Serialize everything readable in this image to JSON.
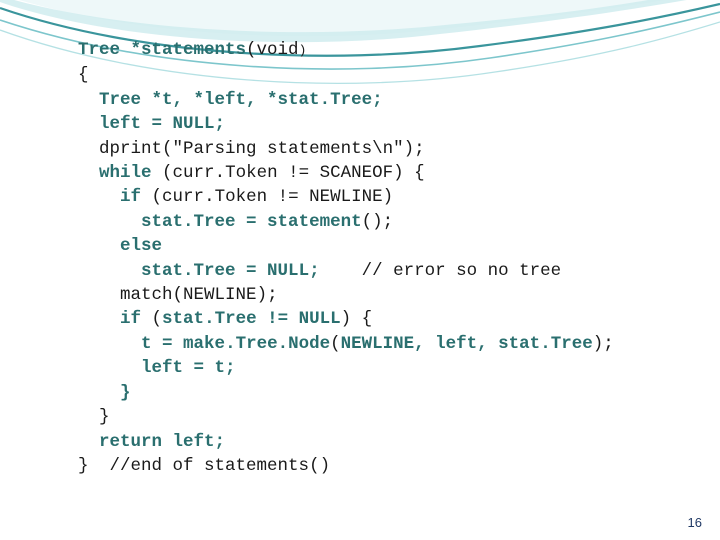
{
  "slide": {
    "page_number": "16",
    "accent_colors": {
      "teal_dark": "#1f6f6f",
      "teal_mid": "#3aa6a6",
      "teal_light": "#9fd9d9",
      "page_number_color": "#1f3864"
    },
    "code": {
      "lines": [
        {
          "indent": 0,
          "segments": [
            {
              "text": "Tree *statements",
              "style": "teal"
            },
            {
              "text": "(",
              "style": "plain"
            },
            {
              "text": "void",
              "style": "plain"
            },
            {
              "text": ")",
              "style": "small"
            }
          ]
        },
        {
          "indent": 0,
          "segments": [
            {
              "text": "{",
              "style": "plain"
            }
          ]
        },
        {
          "indent": 1,
          "segments": [
            {
              "text": "Tree *t, *left, *stat",
              "style": "teal"
            },
            {
              "text": ".",
              "style": "teal"
            },
            {
              "text": "Tree;",
              "style": "teal"
            }
          ]
        },
        {
          "indent": 1,
          "segments": [
            {
              "text": "left",
              "style": "teal"
            },
            {
              "text": " = ",
              "style": "teal"
            },
            {
              "text": "NULL;",
              "style": "teal"
            }
          ]
        },
        {
          "indent": 1,
          "segments": [
            {
              "text": "dprint",
              "style": "plain"
            },
            {
              "text": "(",
              "style": "plain"
            },
            {
              "text": "\"Parsing statements\\n\"",
              "style": "plain"
            },
            {
              "text": ");",
              "style": "plain"
            }
          ]
        },
        {
          "indent": 1,
          "segments": [
            {
              "text": "while",
              "style": "teal"
            },
            {
              "text": " (",
              "style": "plain"
            },
            {
              "text": "curr",
              "style": "plain"
            },
            {
              "text": ".",
              "style": "plain"
            },
            {
              "text": "Token != SCANEOF",
              "style": "plain"
            },
            {
              "text": ") {",
              "style": "plain"
            }
          ]
        },
        {
          "indent": 2,
          "segments": [
            {
              "text": "if",
              "style": "teal"
            },
            {
              "text": " (",
              "style": "plain"
            },
            {
              "text": "curr",
              "style": "plain"
            },
            {
              "text": ".",
              "style": "plain"
            },
            {
              "text": "Token != NEWLINE",
              "style": "plain"
            },
            {
              "text": ")",
              "style": "plain"
            }
          ]
        },
        {
          "indent": 3,
          "segments": [
            {
              "text": "stat",
              "style": "teal"
            },
            {
              "text": ".",
              "style": "teal"
            },
            {
              "text": "Tree = statement",
              "style": "teal"
            },
            {
              "text": "();",
              "style": "plain"
            }
          ]
        },
        {
          "indent": 2,
          "segments": [
            {
              "text": "else",
              "style": "teal"
            }
          ]
        },
        {
          "indent": 3,
          "segments": [
            {
              "text": "stat",
              "style": "teal"
            },
            {
              "text": ".",
              "style": "teal"
            },
            {
              "text": "Tree = NULL;",
              "style": "teal"
            },
            {
              "text": "    // error so no tree",
              "style": "plain"
            }
          ]
        },
        {
          "indent": 2,
          "segments": [
            {
              "text": "match",
              "style": "plain"
            },
            {
              "text": "(",
              "style": "plain"
            },
            {
              "text": "NEWLINE",
              "style": "plain"
            },
            {
              "text": ");",
              "style": "plain"
            }
          ]
        },
        {
          "indent": 2,
          "segments": [
            {
              "text": "if",
              "style": "teal"
            },
            {
              "text": " (",
              "style": "plain"
            },
            {
              "text": "stat",
              "style": "teal"
            },
            {
              "text": ".",
              "style": "teal"
            },
            {
              "text": "Tree != NULL",
              "style": "teal"
            },
            {
              "text": ") {",
              "style": "plain"
            }
          ]
        },
        {
          "indent": 3,
          "segments": [
            {
              "text": "t",
              "style": "teal"
            },
            {
              "text": " = ",
              "style": "teal"
            },
            {
              "text": "make",
              "style": "teal"
            },
            {
              "text": ".",
              "style": "teal"
            },
            {
              "text": "Tree",
              "style": "teal"
            },
            {
              "text": ".",
              "style": "teal"
            },
            {
              "text": "Node",
              "style": "teal"
            },
            {
              "text": "(",
              "style": "plain"
            },
            {
              "text": "NEWLINE, left, stat",
              "style": "teal"
            },
            {
              "text": ".",
              "style": "teal"
            },
            {
              "text": "Tree",
              "style": "teal"
            },
            {
              "text": ");",
              "style": "plain"
            }
          ]
        },
        {
          "indent": 3,
          "segments": [
            {
              "text": "left",
              "style": "teal"
            },
            {
              "text": " = ",
              "style": "teal"
            },
            {
              "text": "t;",
              "style": "teal"
            }
          ]
        },
        {
          "indent": 2,
          "segments": [
            {
              "text": "}",
              "style": "teal"
            }
          ]
        },
        {
          "indent": 1,
          "segments": [
            {
              "text": "}",
              "style": "plain"
            }
          ]
        },
        {
          "indent": 1,
          "segments": [
            {
              "text": "return left;",
              "style": "teal"
            }
          ]
        },
        {
          "indent": 0,
          "segments": [
            {
              "text": "}",
              "style": "plain"
            },
            {
              "text": "  //",
              "style": "plain"
            },
            {
              "text": "end of statements",
              "style": "plain"
            },
            {
              "text": "()",
              "style": "plain"
            }
          ]
        }
      ],
      "raw_text": "Tree *statements(void)\n{\n  Tree *t, *left, *stat.Tree;\n  left = NULL;\n  dprint(\"Parsing statements\\n\");\n  while (curr.Token != SCANEOF) {\n    if (curr.Token != NEWLINE)\n      stat.Tree = statement();\n    else\n      stat.Tree = NULL;    // error so no tree\n    match(NEWLINE);\n    if (stat.Tree != NULL) {\n      t = make.Tree.Node(NEWLINE, left, stat.Tree);\n      left = t;\n    }\n  }\n  return left;\n}  //end of statements()"
    }
  }
}
